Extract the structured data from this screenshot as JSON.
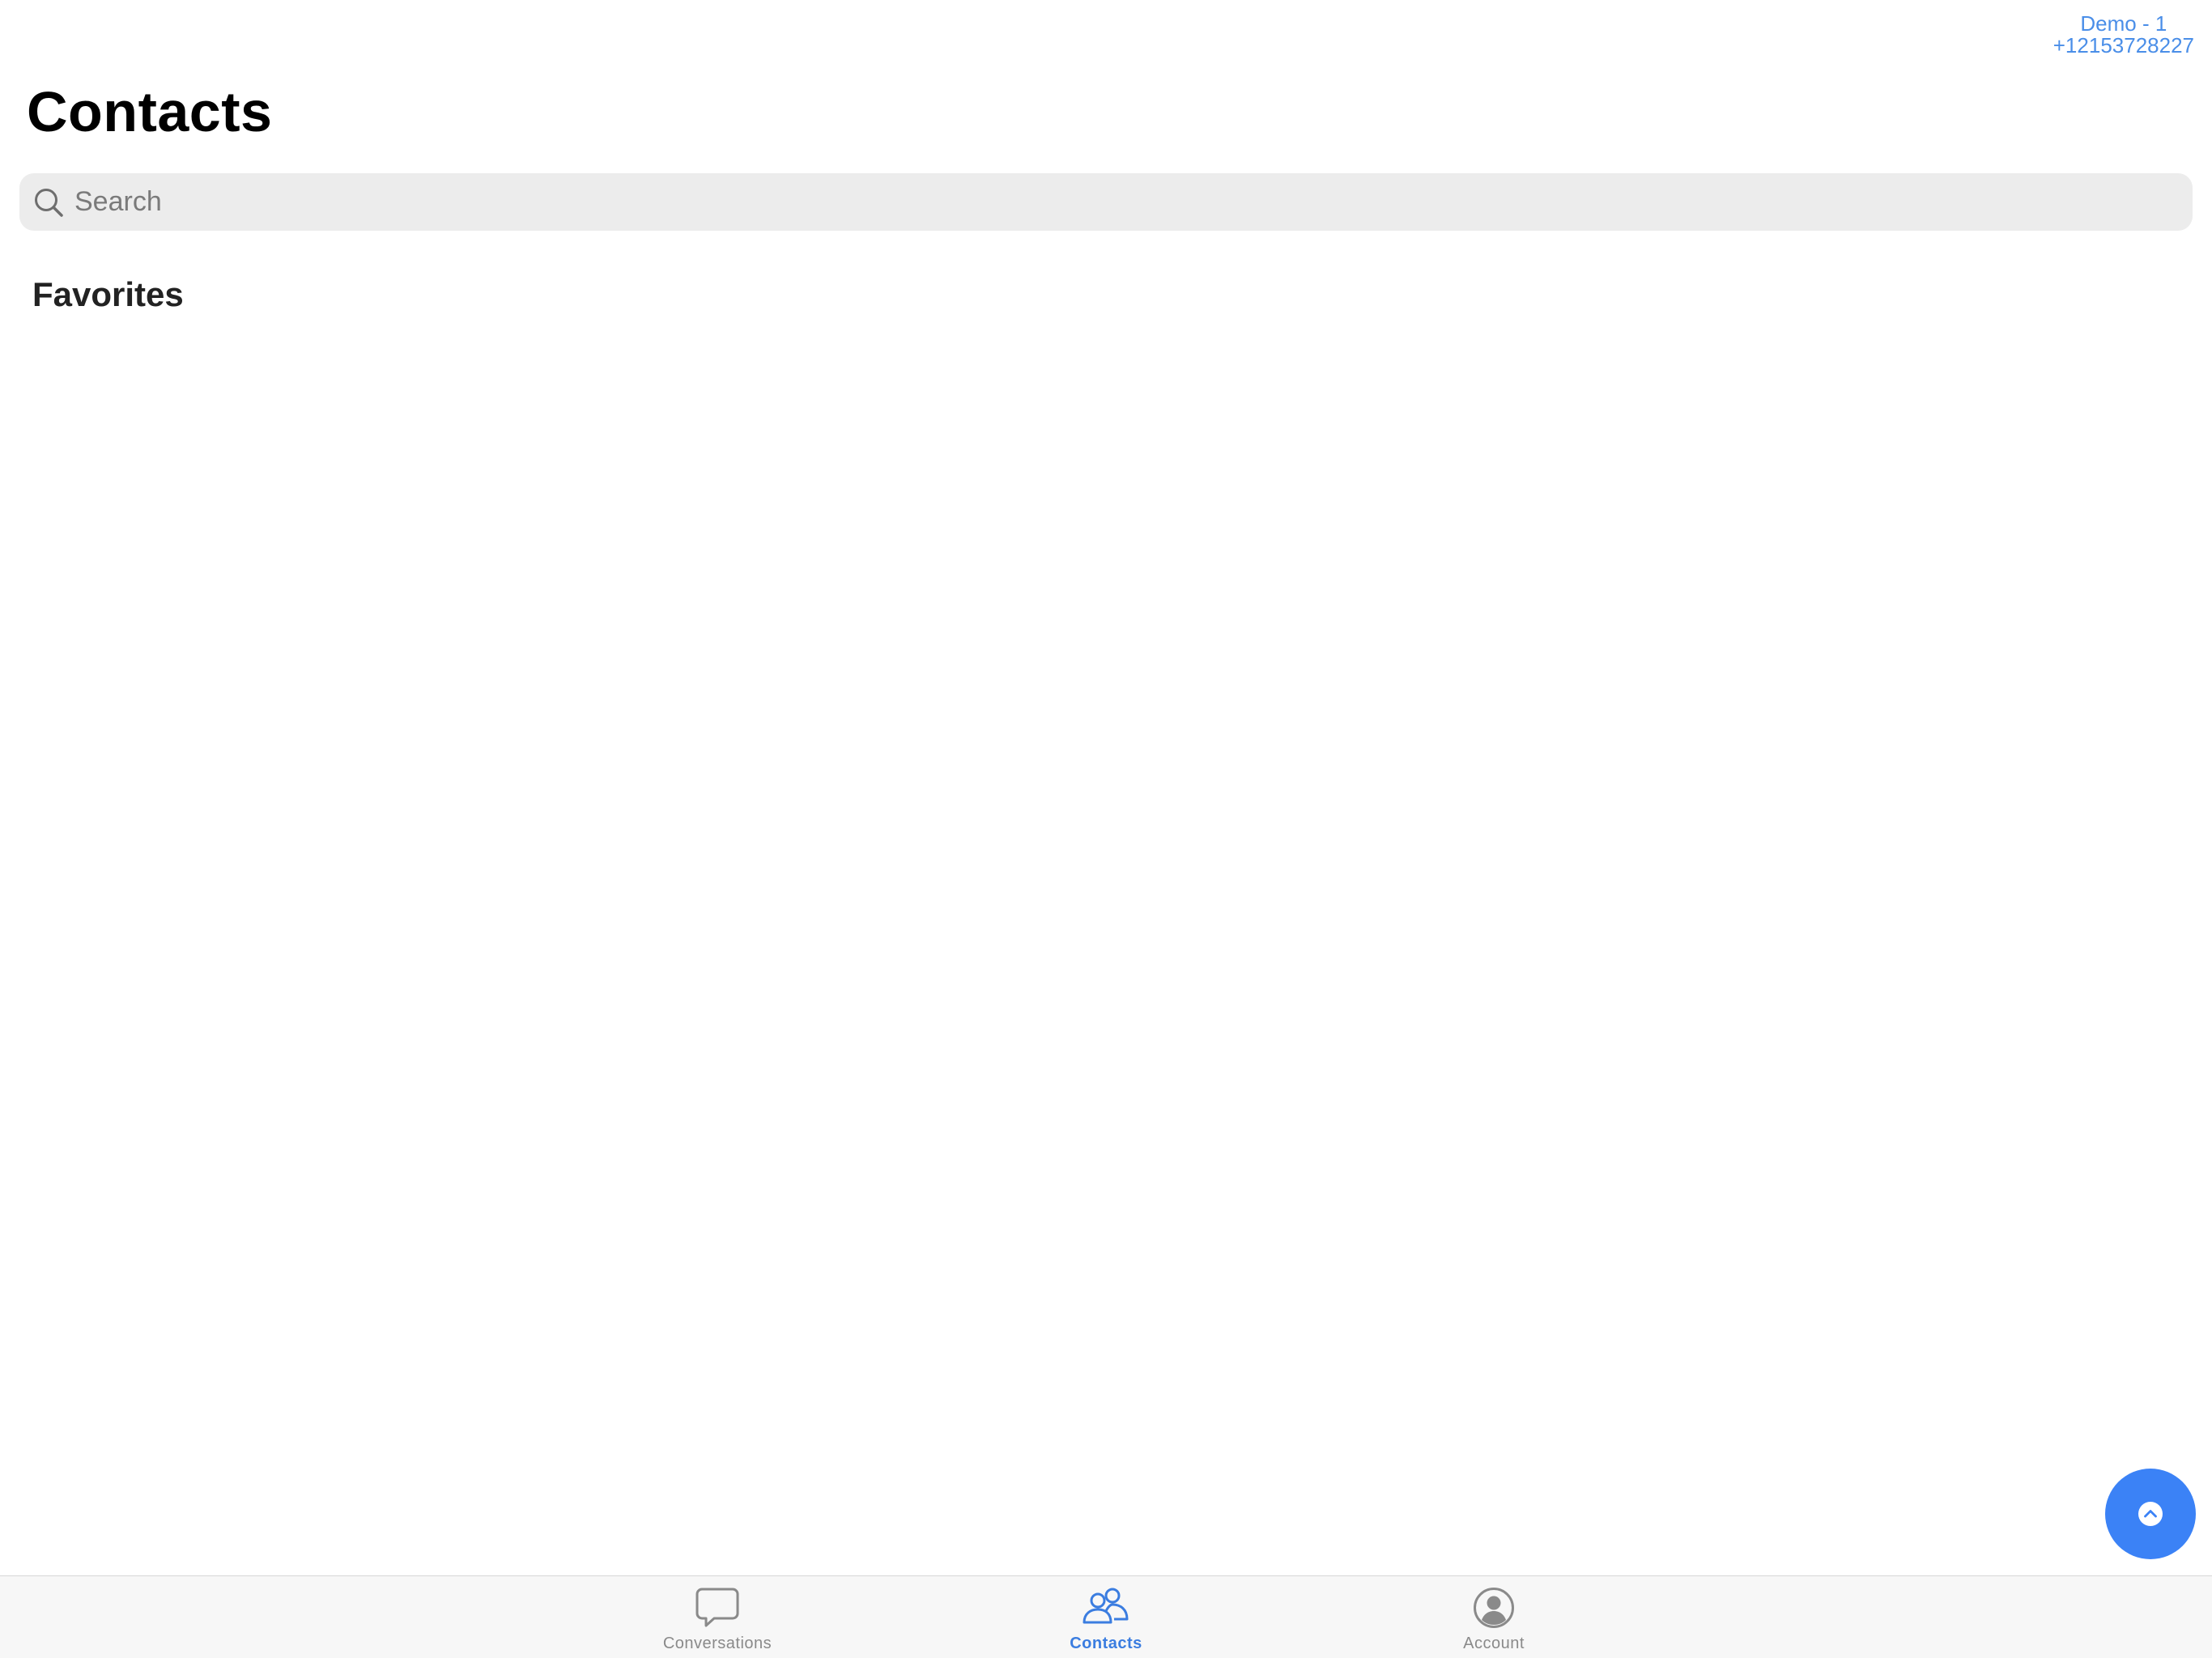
{
  "account": {
    "name": "Demo - 1",
    "phone": "+12153728227"
  },
  "header": {
    "title": "Contacts"
  },
  "search": {
    "placeholder": "Search",
    "value": ""
  },
  "sections": {
    "favorites_heading": "Favorites"
  },
  "fab": {
    "icon": "chevron-up-icon"
  },
  "tab_bar": {
    "active": "Contacts",
    "tabs": [
      {
        "label": "Conversations",
        "icon": "chat-bubble-icon"
      },
      {
        "label": "Contacts",
        "icon": "people-icon"
      },
      {
        "label": "Account",
        "icon": "user-circle-icon"
      }
    ]
  },
  "colors": {
    "accent": "#3b82f6",
    "account_text": "#4a8ee8",
    "inactive_tab": "#8a8a8a",
    "search_bg": "#ececec"
  }
}
